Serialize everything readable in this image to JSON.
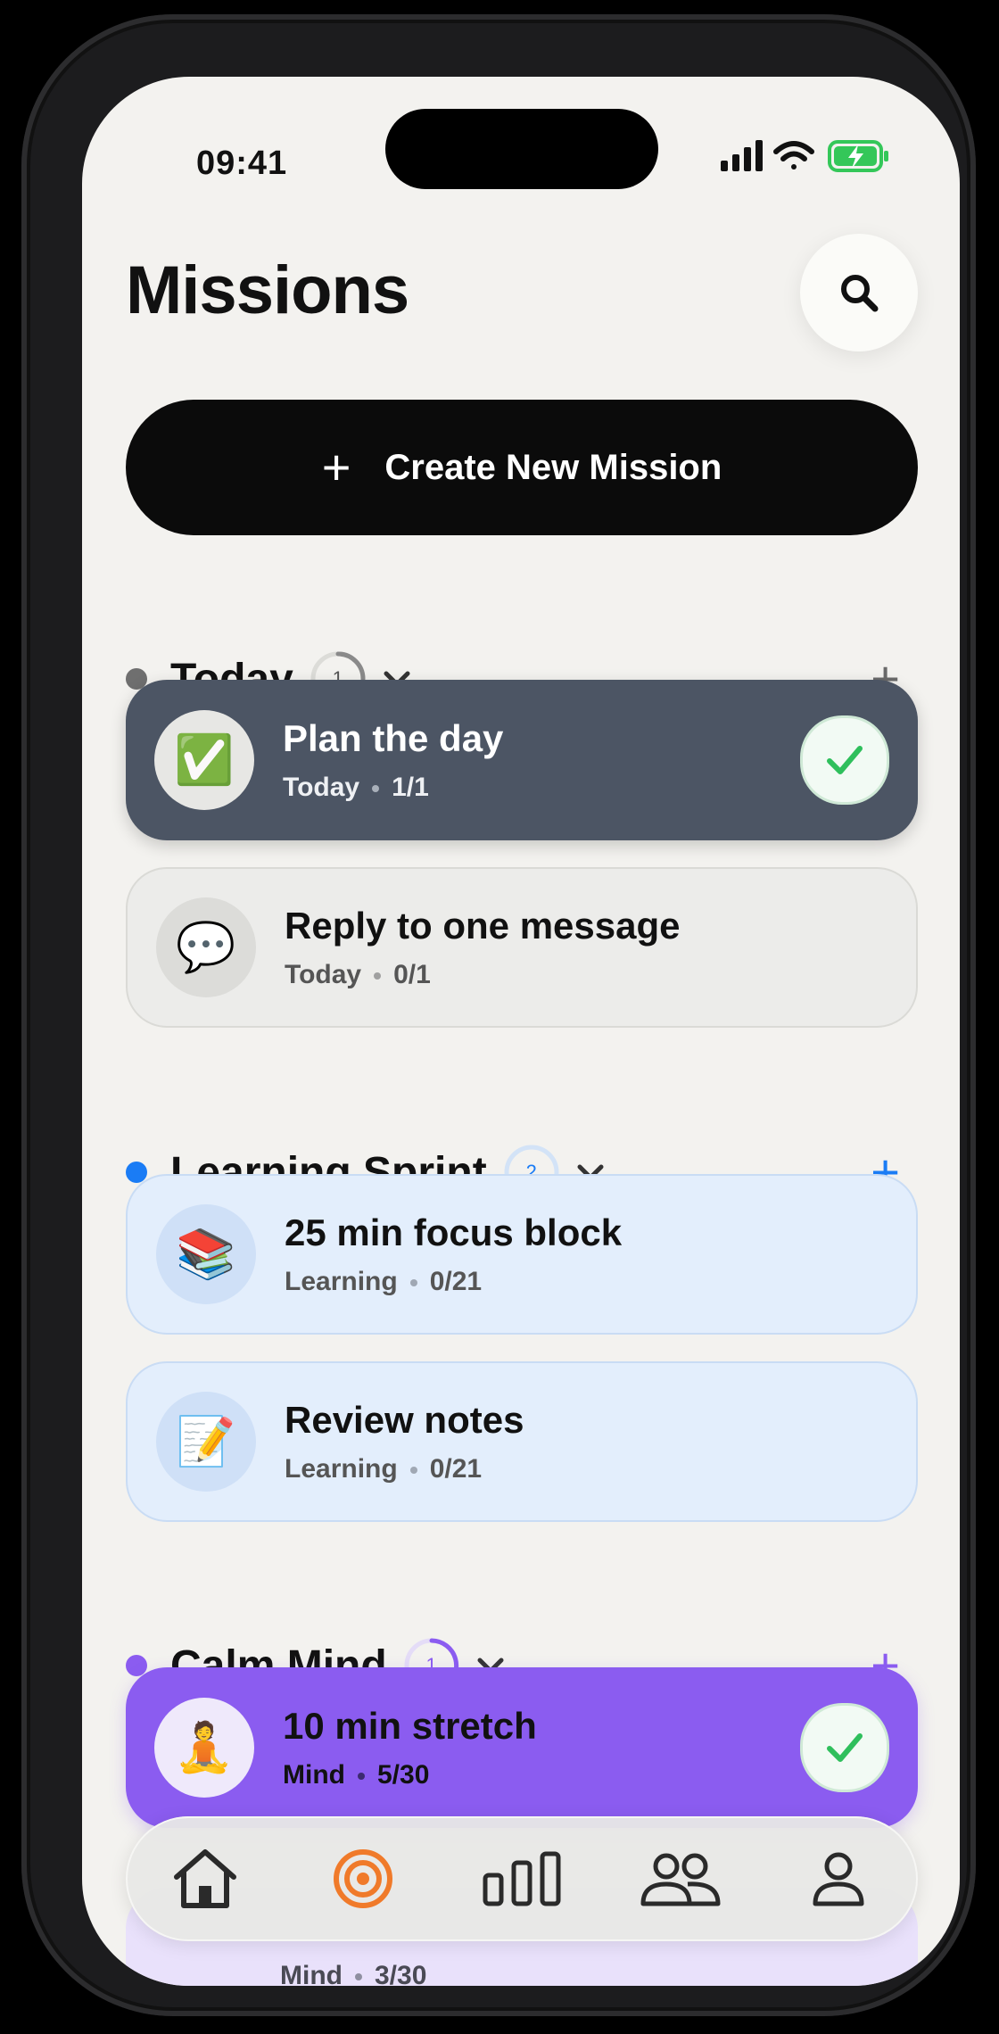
{
  "status": {
    "time": "09:41"
  },
  "header": {
    "title": "Missions"
  },
  "create": {
    "label": "Create New Mission"
  },
  "sections": [
    {
      "title": "Today",
      "count": "1",
      "color": "#6f6f6f",
      "missions": [
        {
          "name": "Plan the day",
          "category": "Today",
          "progress": "1/1",
          "icon": "✅",
          "completed": true
        },
        {
          "name": "Reply to one message",
          "category": "Today",
          "progress": "0/1",
          "icon": "💬",
          "completed": false
        }
      ]
    },
    {
      "title": "Learning Sprint",
      "count": "2",
      "color": "#1a7cf5",
      "missions": [
        {
          "name": "25 min focus block",
          "category": "Learning",
          "progress": "0/21",
          "icon": "📚",
          "completed": false
        },
        {
          "name": "Review notes",
          "category": "Learning",
          "progress": "0/21",
          "icon": "📝",
          "completed": false
        }
      ]
    },
    {
      "title": "Calm Mind",
      "count": "1",
      "color": "#8b5cf0",
      "missions": [
        {
          "name": "10 min stretch",
          "category": "Mind",
          "progress": "5/30",
          "icon": "🧘",
          "completed": true
        },
        {
          "category": "Mind",
          "progress": "3/30"
        }
      ]
    }
  ],
  "tabs": [
    {
      "icon": "home-icon",
      "active": false
    },
    {
      "icon": "target-icon",
      "active": true,
      "color": "#f07a2a"
    },
    {
      "icon": "stats-icon",
      "active": false
    },
    {
      "icon": "friends-icon",
      "active": false
    },
    {
      "icon": "profile-icon",
      "active": false
    }
  ]
}
